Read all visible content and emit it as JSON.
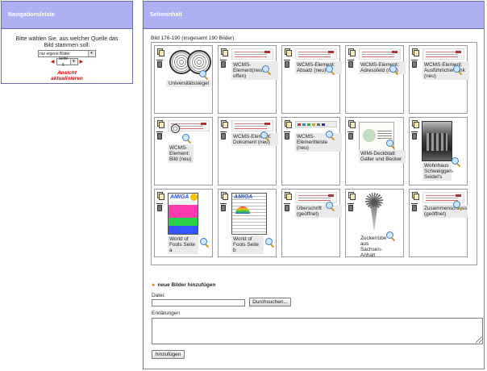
{
  "nav": {
    "title": "Navigationsleiste",
    "prompt": "Bitte wählen Sie, aus welcher Quelle das Bild stammen soll:",
    "source_select": "nur eigene Bilder",
    "page_select": "Seite 6",
    "refresh_line1": "Ansicht",
    "refresh_line2": "aktualisieren"
  },
  "content": {
    "title": "Seiteninhalt",
    "image_count": "Bild 176-190 (insgesamt 190 Bilder)",
    "images": [
      {
        "caption": "Universitätssiegel",
        "kind": "seal"
      },
      {
        "caption": "WCMS-Element(neu, offen)",
        "kind": "doc"
      },
      {
        "caption": "WCMS-Element: Absatz (neu)",
        "kind": "doc"
      },
      {
        "caption": "WCMS-Element: Adressfeld (neu)",
        "kind": "doc"
      },
      {
        "caption": "WCMS-Element: Ausführlicher Link (neu)",
        "kind": "doc"
      },
      {
        "caption": "WCMS-Element: Bild (neu)",
        "kind": "doc-photo"
      },
      {
        "caption": "WCMS-Element: Dokument (neu)",
        "kind": "doc"
      },
      {
        "caption": "WCMS-Elementleiste (neu)",
        "kind": "bar"
      },
      {
        "caption": "WiMi-Deckblatt Galler und Becker",
        "kind": "wim"
      },
      {
        "caption": "Wohnhaus Schweiggen-Seidel's",
        "kind": "photo"
      },
      {
        "caption": "World of Fools Seite a",
        "kind": "amiga"
      },
      {
        "caption": "World of Fools Seite b",
        "kind": "amiga2"
      },
      {
        "caption": "Überschrift (geöffnet)",
        "kind": "doc"
      },
      {
        "caption": "Zuckerrübe aus Sachsen-Anhalt",
        "kind": "plant"
      },
      {
        "caption": "Zusammenschluss (geöffnet)",
        "kind": "doc"
      }
    ],
    "new_images_heading": "neue Bilder hinzufügen",
    "file_label": "Datei:",
    "file_value": "",
    "browse_label": "Durchsuchen...",
    "notes_label": "Erklärungen",
    "notes_value": "",
    "add_label": "hinzufügen"
  },
  "amiga_logo": "AMIGA",
  "colors": {
    "header_bg": "#aeb0f4",
    "refresh_red": "#e00000",
    "border": "#6b6ba8"
  }
}
